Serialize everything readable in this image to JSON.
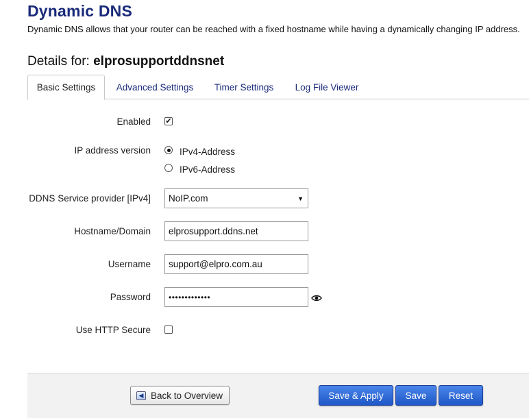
{
  "page": {
    "title": "Dynamic DNS",
    "description": "Dynamic DNS allows that your router can be reached with a fixed hostname while having a dynamically changing IP address."
  },
  "details": {
    "label": "Details for: ",
    "name": "elprosupportddnsnet"
  },
  "tabs": [
    {
      "label": "Basic Settings",
      "active": true
    },
    {
      "label": "Advanced Settings",
      "active": false
    },
    {
      "label": "Timer Settings",
      "active": false
    },
    {
      "label": "Log File Viewer",
      "active": false
    }
  ],
  "form": {
    "enabled": {
      "label": "Enabled",
      "checked": true,
      "mark": "✔"
    },
    "ip_version": {
      "label": "IP address version",
      "options": [
        {
          "label": "IPv4-Address",
          "checked": true
        },
        {
          "label": "IPv6-Address",
          "checked": false
        }
      ]
    },
    "provider": {
      "label": "DDNS Service provider [IPv4]",
      "value": "NoIP.com",
      "arrow": "▼"
    },
    "hostname": {
      "label": "Hostname/Domain",
      "value": "elprosupport.ddns.net"
    },
    "username": {
      "label": "Username",
      "value": "support@elpro.com.au"
    },
    "password": {
      "label": "Password",
      "value": "•••••••••••••",
      "reveal_icon": "eye-icon"
    },
    "https": {
      "label": "Use HTTP Secure",
      "checked": false
    }
  },
  "footer": {
    "back_label": "Back to Overview",
    "back_icon": "back-arrow-icon",
    "save_apply_label": "Save & Apply",
    "save_label": "Save",
    "reset_label": "Reset"
  },
  "colors": {
    "title": "#1a2a7a",
    "primary_button": "#2f6bd8",
    "footer_bg": "#f2f2f2"
  }
}
